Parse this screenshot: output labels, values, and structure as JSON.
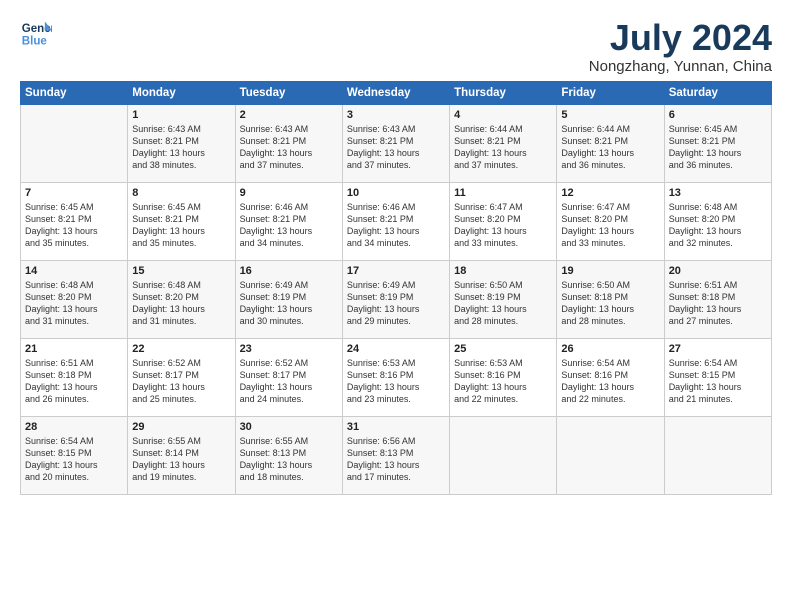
{
  "logo": {
    "line1": "General",
    "line2": "Blue"
  },
  "title": "July 2024",
  "location": "Nongzhang, Yunnan, China",
  "columns": [
    "Sunday",
    "Monday",
    "Tuesday",
    "Wednesday",
    "Thursday",
    "Friday",
    "Saturday"
  ],
  "weeks": [
    [
      {
        "day": "",
        "content": ""
      },
      {
        "day": "1",
        "content": "Sunrise: 6:43 AM\nSunset: 8:21 PM\nDaylight: 13 hours\nand 38 minutes."
      },
      {
        "day": "2",
        "content": "Sunrise: 6:43 AM\nSunset: 8:21 PM\nDaylight: 13 hours\nand 37 minutes."
      },
      {
        "day": "3",
        "content": "Sunrise: 6:43 AM\nSunset: 8:21 PM\nDaylight: 13 hours\nand 37 minutes."
      },
      {
        "day": "4",
        "content": "Sunrise: 6:44 AM\nSunset: 8:21 PM\nDaylight: 13 hours\nand 37 minutes."
      },
      {
        "day": "5",
        "content": "Sunrise: 6:44 AM\nSunset: 8:21 PM\nDaylight: 13 hours\nand 36 minutes."
      },
      {
        "day": "6",
        "content": "Sunrise: 6:45 AM\nSunset: 8:21 PM\nDaylight: 13 hours\nand 36 minutes."
      }
    ],
    [
      {
        "day": "7",
        "content": "Sunrise: 6:45 AM\nSunset: 8:21 PM\nDaylight: 13 hours\nand 35 minutes."
      },
      {
        "day": "8",
        "content": "Sunrise: 6:45 AM\nSunset: 8:21 PM\nDaylight: 13 hours\nand 35 minutes."
      },
      {
        "day": "9",
        "content": "Sunrise: 6:46 AM\nSunset: 8:21 PM\nDaylight: 13 hours\nand 34 minutes."
      },
      {
        "day": "10",
        "content": "Sunrise: 6:46 AM\nSunset: 8:21 PM\nDaylight: 13 hours\nand 34 minutes."
      },
      {
        "day": "11",
        "content": "Sunrise: 6:47 AM\nSunset: 8:20 PM\nDaylight: 13 hours\nand 33 minutes."
      },
      {
        "day": "12",
        "content": "Sunrise: 6:47 AM\nSunset: 8:20 PM\nDaylight: 13 hours\nand 33 minutes."
      },
      {
        "day": "13",
        "content": "Sunrise: 6:48 AM\nSunset: 8:20 PM\nDaylight: 13 hours\nand 32 minutes."
      }
    ],
    [
      {
        "day": "14",
        "content": "Sunrise: 6:48 AM\nSunset: 8:20 PM\nDaylight: 13 hours\nand 31 minutes."
      },
      {
        "day": "15",
        "content": "Sunrise: 6:48 AM\nSunset: 8:20 PM\nDaylight: 13 hours\nand 31 minutes."
      },
      {
        "day": "16",
        "content": "Sunrise: 6:49 AM\nSunset: 8:19 PM\nDaylight: 13 hours\nand 30 minutes."
      },
      {
        "day": "17",
        "content": "Sunrise: 6:49 AM\nSunset: 8:19 PM\nDaylight: 13 hours\nand 29 minutes."
      },
      {
        "day": "18",
        "content": "Sunrise: 6:50 AM\nSunset: 8:19 PM\nDaylight: 13 hours\nand 28 minutes."
      },
      {
        "day": "19",
        "content": "Sunrise: 6:50 AM\nSunset: 8:18 PM\nDaylight: 13 hours\nand 28 minutes."
      },
      {
        "day": "20",
        "content": "Sunrise: 6:51 AM\nSunset: 8:18 PM\nDaylight: 13 hours\nand 27 minutes."
      }
    ],
    [
      {
        "day": "21",
        "content": "Sunrise: 6:51 AM\nSunset: 8:18 PM\nDaylight: 13 hours\nand 26 minutes."
      },
      {
        "day": "22",
        "content": "Sunrise: 6:52 AM\nSunset: 8:17 PM\nDaylight: 13 hours\nand 25 minutes."
      },
      {
        "day": "23",
        "content": "Sunrise: 6:52 AM\nSunset: 8:17 PM\nDaylight: 13 hours\nand 24 minutes."
      },
      {
        "day": "24",
        "content": "Sunrise: 6:53 AM\nSunset: 8:16 PM\nDaylight: 13 hours\nand 23 minutes."
      },
      {
        "day": "25",
        "content": "Sunrise: 6:53 AM\nSunset: 8:16 PM\nDaylight: 13 hours\nand 22 minutes."
      },
      {
        "day": "26",
        "content": "Sunrise: 6:54 AM\nSunset: 8:16 PM\nDaylight: 13 hours\nand 22 minutes."
      },
      {
        "day": "27",
        "content": "Sunrise: 6:54 AM\nSunset: 8:15 PM\nDaylight: 13 hours\nand 21 minutes."
      }
    ],
    [
      {
        "day": "28",
        "content": "Sunrise: 6:54 AM\nSunset: 8:15 PM\nDaylight: 13 hours\nand 20 minutes."
      },
      {
        "day": "29",
        "content": "Sunrise: 6:55 AM\nSunset: 8:14 PM\nDaylight: 13 hours\nand 19 minutes."
      },
      {
        "day": "30",
        "content": "Sunrise: 6:55 AM\nSunset: 8:13 PM\nDaylight: 13 hours\nand 18 minutes."
      },
      {
        "day": "31",
        "content": "Sunrise: 6:56 AM\nSunset: 8:13 PM\nDaylight: 13 hours\nand 17 minutes."
      },
      {
        "day": "",
        "content": ""
      },
      {
        "day": "",
        "content": ""
      },
      {
        "day": "",
        "content": ""
      }
    ]
  ]
}
